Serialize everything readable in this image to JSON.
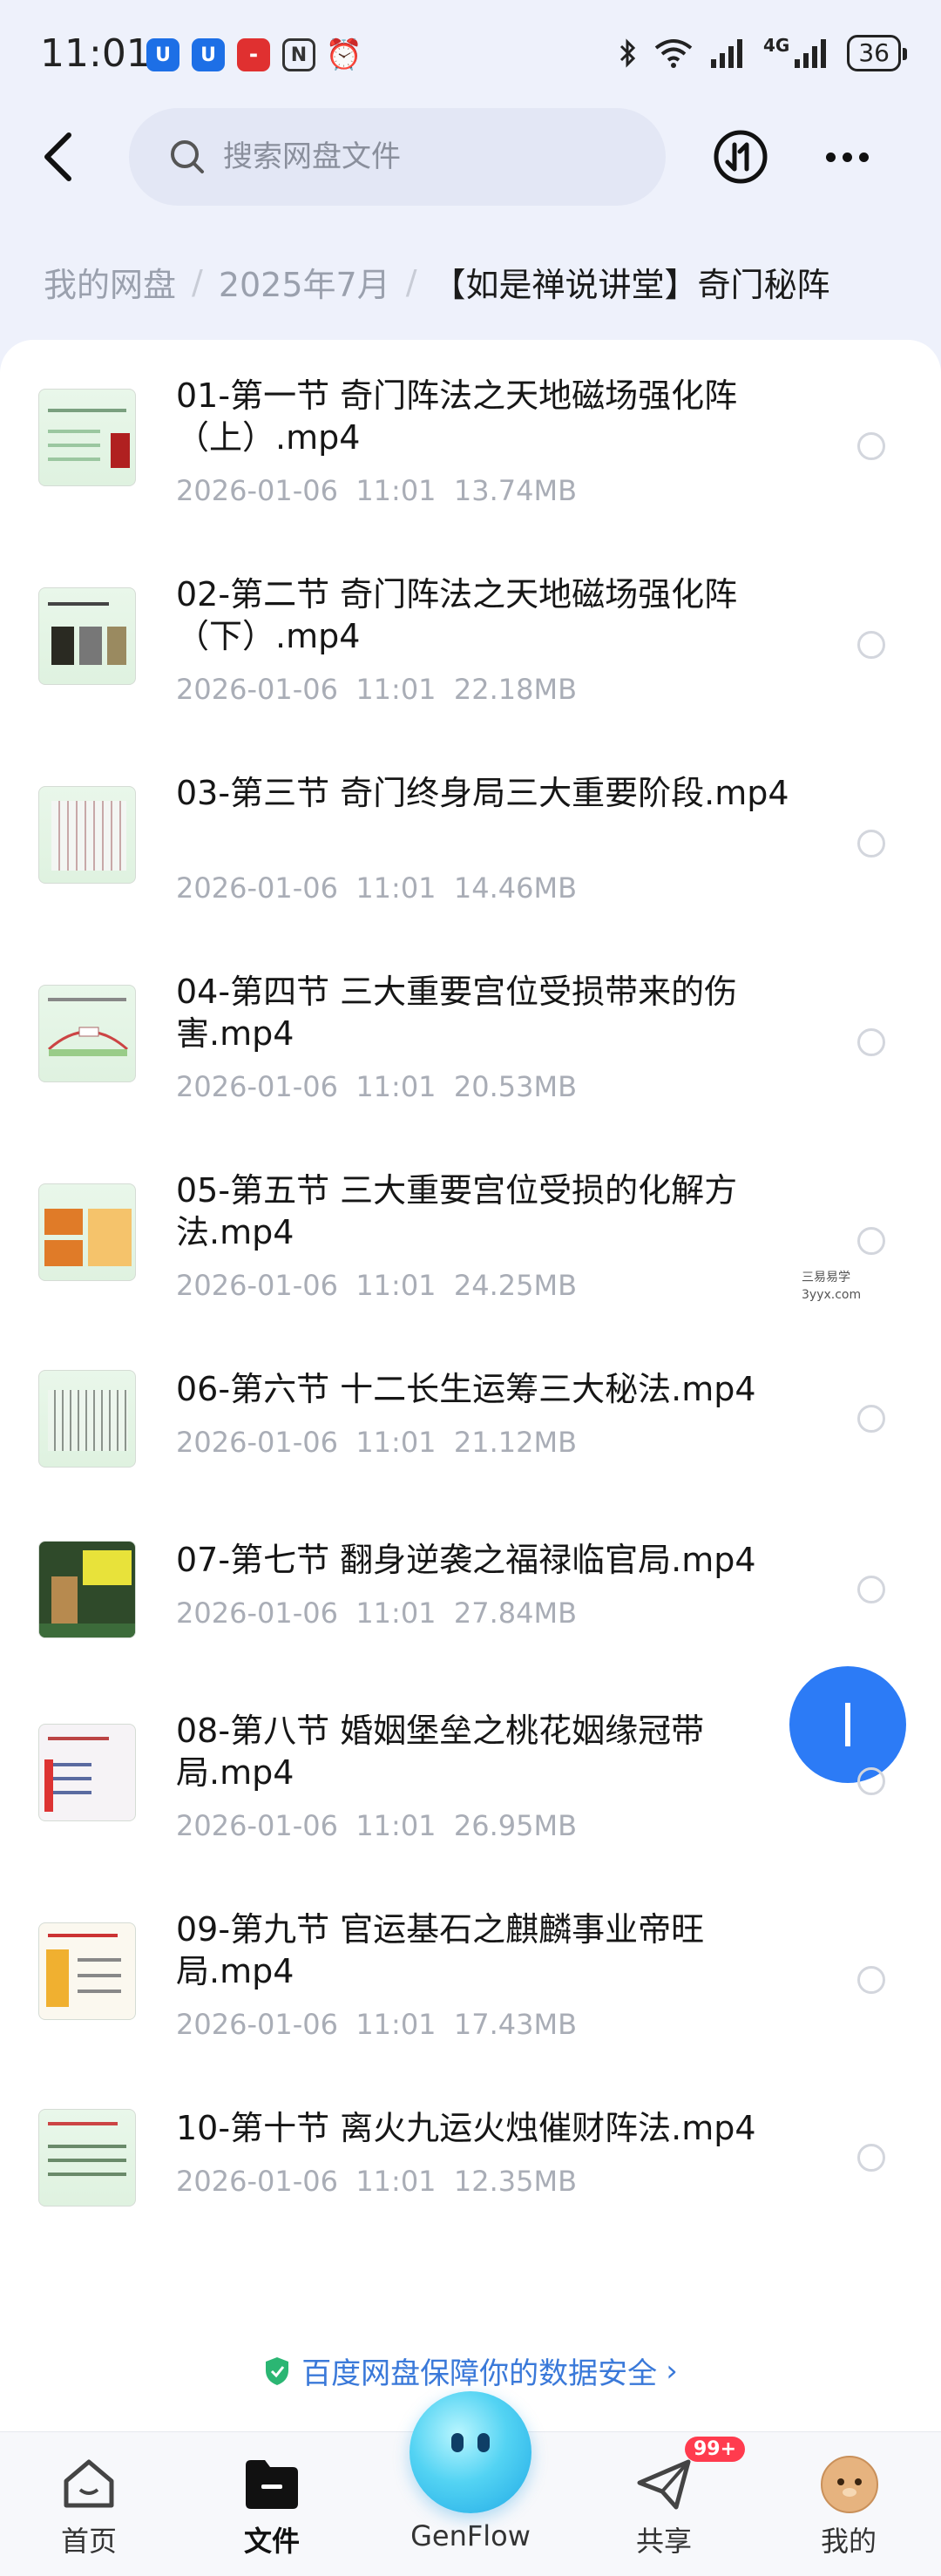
{
  "status_bar": {
    "time": "11:01",
    "network": "4G",
    "battery": "36",
    "apps": [
      {
        "icon": "app-shield-icon",
        "label": "U",
        "color": "#1d6fe6"
      },
      {
        "icon": "app-shield2-icon",
        "label": "U",
        "color": "#1d6fe6"
      },
      {
        "icon": "huawei-icon",
        "label": "",
        "color": "#e03030"
      },
      {
        "icon": "nfc-icon",
        "label": "N",
        "color": "#333333"
      },
      {
        "icon": "alarm-off-icon",
        "label": "",
        "color": "#333333"
      }
    ]
  },
  "header": {
    "search_placeholder": "搜索网盘文件"
  },
  "breadcrumb": {
    "items": [
      "我的网盘",
      "2025年7月"
    ],
    "current": "【如是禅说讲堂】奇门秘阵"
  },
  "files": [
    {
      "name": "01-第一节 奇门阵法之天地磁场强化阵（上）.mp4",
      "meta": "2026-01-06  11:01  13.74MB"
    },
    {
      "name": "02-第二节 奇门阵法之天地磁场强化阵（下）.mp4",
      "meta": "2026-01-06  11:01  22.18MB"
    },
    {
      "name": "03-第三节 奇门终身局三大重要阶段.mp4",
      "meta": "2026-01-06  11:01  14.46MB"
    },
    {
      "name": "04-第四节 三大重要宫位受损带来的伤害.mp4",
      "meta": "2026-01-06  11:01  20.53MB"
    },
    {
      "name": "05-第五节 三大重要宫位受损的化解方法.mp4",
      "meta": "2026-01-06  11:01  24.25MB"
    },
    {
      "name": "06-第六节 十二长生运筹三大秘法.mp4",
      "meta": "2026-01-06  11:01  21.12MB"
    },
    {
      "name": "07-第七节 翻身逆袭之福禄临官局.mp4",
      "meta": "2026-01-06  11:01  27.84MB"
    },
    {
      "name": "08-第八节 婚姻堡垒之桃花姻缘冠带局.mp4",
      "meta": "2026-01-06  11:01  26.95MB"
    },
    {
      "name": "09-第九节 官运基石之麒麟事业帝旺局.mp4",
      "meta": "2026-01-06  11:01  17.43MB"
    },
    {
      "name": "10-第十节 离火九运火烛催财阵法.mp4",
      "meta": "2026-01-06  11:01  12.35MB"
    }
  ],
  "watermark": {
    "line1": "三易易学",
    "line2": "3yyx.com"
  },
  "safety_text": "百度网盘保障你的数据安全",
  "bottom_nav": {
    "items": [
      {
        "label": "首页",
        "icon": "home-icon"
      },
      {
        "label": "文件",
        "icon": "folder-icon"
      },
      {
        "label": "GenFlow",
        "icon": "genflow-orb-icon"
      },
      {
        "label": "共享",
        "icon": "paper-plane-icon"
      },
      {
        "label": "我的",
        "icon": "avatar-icon"
      }
    ],
    "share_badge": "99+"
  },
  "colors": {
    "accent": "#2c7bf6",
    "safety_text": "#3a79d9",
    "meta_text": "#a9adb6",
    "badge": "#ff3b4e"
  }
}
